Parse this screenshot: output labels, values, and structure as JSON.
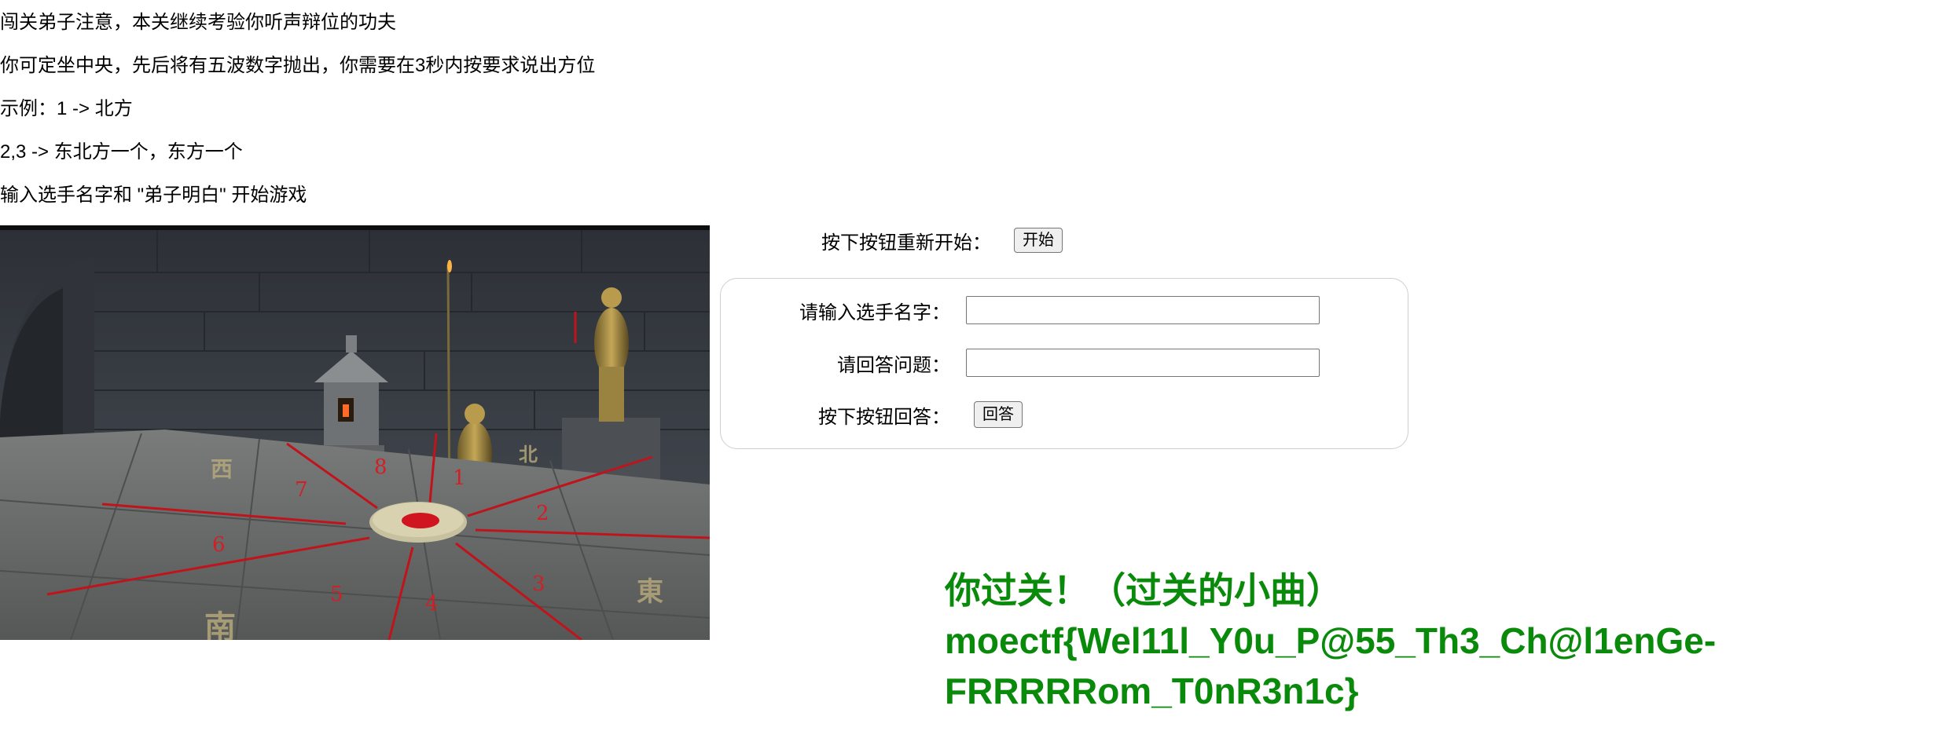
{
  "intro": {
    "line1": "闯关弟子注意，本关继续考验你听声辩位的功夫",
    "line2": "你可定坐中央，先后将有五波数字抛出，你需要在3秒内按要求说出方位",
    "line3": "示例：1 -> 北方",
    "line4": "2,3 -> 东北方一个，东方一个",
    "line5": "输入选手名字和 \"弟子明白\" 开始游戏"
  },
  "scene": {
    "direction_numbers": [
      "1",
      "2",
      "3",
      "4",
      "5",
      "6",
      "7",
      "8"
    ],
    "floor_glyphs": [
      "西",
      "東",
      "北",
      "南"
    ],
    "colors": {
      "rope": "#c0141c",
      "target_center": "#d01520",
      "number": "#d21f26",
      "floor": "#6b6e6e",
      "wall": "#3a3e44"
    }
  },
  "controls": {
    "restart_label": "按下按钮重新开始：",
    "start_button": "开始",
    "name_label": "请输入选手名字：",
    "name_value": "",
    "answer_label": "请回答问题：",
    "answer_value": "",
    "submit_label": "按下按钮回答：",
    "submit_button": "回答"
  },
  "result": {
    "message": "你过关！（过关的小曲）",
    "flag_line1": "moectf{Wel11l_Y0u_P@55_Th3_Ch@l1enGe-",
    "flag_line2": "FRRRRRom_T0nR3n1c}",
    "color": "#0a8a0a"
  }
}
